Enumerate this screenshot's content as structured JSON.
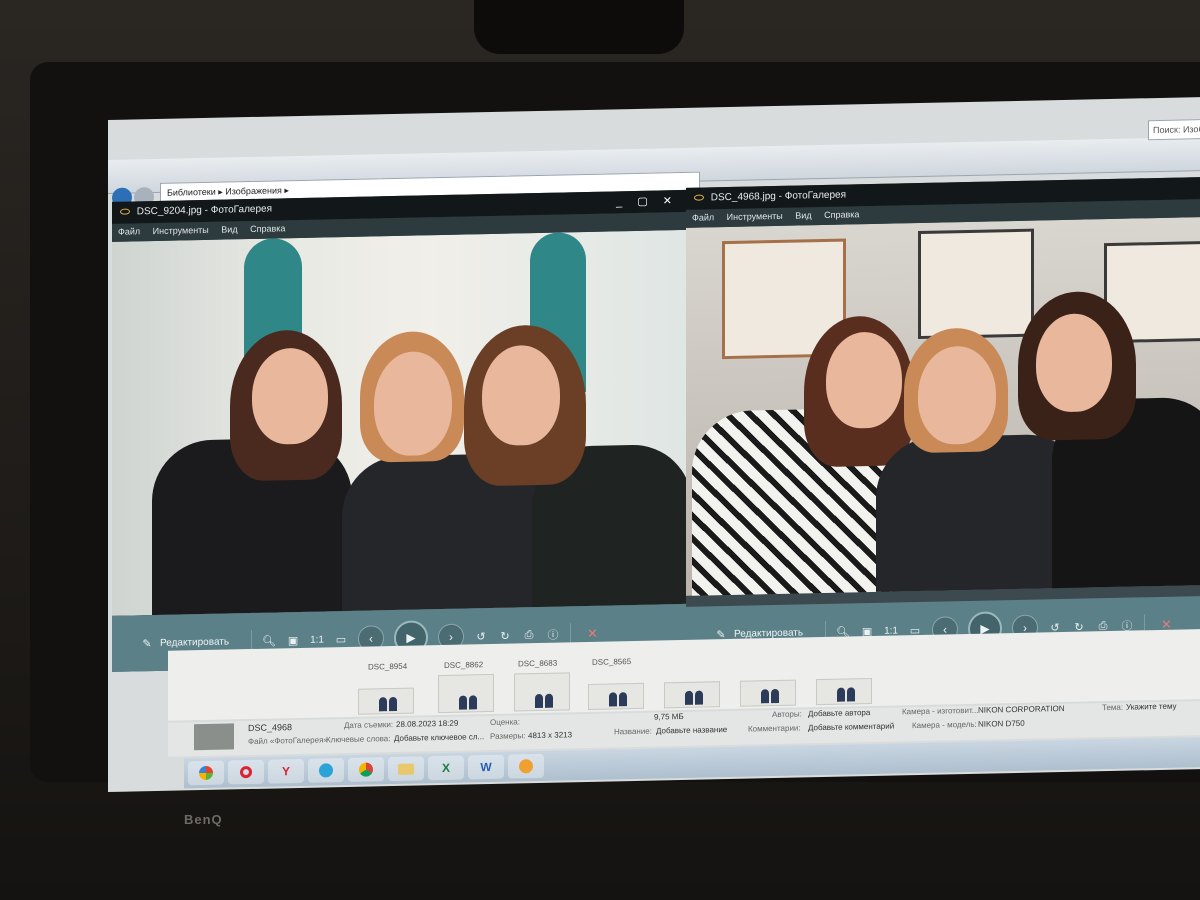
{
  "explorer": {
    "breadcrumb": "Библиотеки ▸ Изображения ▸",
    "search_placeholder": "Поиск: Изображе"
  },
  "viewer_left": {
    "title": "DSC_9204.jpg - ФотоГалерея",
    "menu": [
      "Файл",
      "Инструменты",
      "Вид",
      "Справка"
    ],
    "edit_label": "Редактировать",
    "zoom_1to1": "1:1"
  },
  "viewer_right": {
    "title": "DSC_4968.jpg - ФотоГалерея",
    "menu": [
      "Файл",
      "Инструменты",
      "Вид",
      "Справка"
    ],
    "edit_label": "Редактировать",
    "zoom_1to1": "1:1"
  },
  "thumbnails": {
    "labels": [
      "DSC_8954",
      "DSC_8862",
      "DSC_8683",
      "DSC_8565"
    ]
  },
  "details": {
    "filename": "DSC_4968",
    "file_type": "Файл «ФотоГалерея»",
    "keywords_label": "Ключевые слова:",
    "keywords_value": "Добавьте ключевое сл...",
    "date_label": "Дата съемки:",
    "date_value": "28.08.2023 18:29",
    "rating_label": "Оценка:",
    "size_label": "Размеры:",
    "size_value": "4813 x 3213",
    "filesize_value": "9,75 МБ",
    "title_label": "Название:",
    "title_value": "Добавьте название",
    "author_label": "Авторы:",
    "author_value": "Добавьте автора",
    "comments_label": "Комментарии:",
    "comments_value": "Добавьте комментарий",
    "camera_maker_label": "Камера - изготовит...",
    "camera_maker_value": "NIKON CORPORATION",
    "camera_model_label": "Камера - модель:",
    "camera_model_value": "NIKON D750",
    "subject_label": "Тема:",
    "subject_value": "Укажите тему"
  },
  "monitor": {
    "brand": "BenQ"
  },
  "taskbar": {
    "apps": [
      "start-icon",
      "chrome-icon",
      "yandex-icon",
      "telegram-icon",
      "chrome-icon",
      "explorer-icon",
      "excel-icon",
      "word-icon",
      "gallery-icon"
    ],
    "excel_glyph": "X",
    "word_glyph": "W"
  },
  "colors": {
    "toolbar": "#5c8088",
    "titlebar": "#121819",
    "accent_close": "#e87a7a"
  }
}
